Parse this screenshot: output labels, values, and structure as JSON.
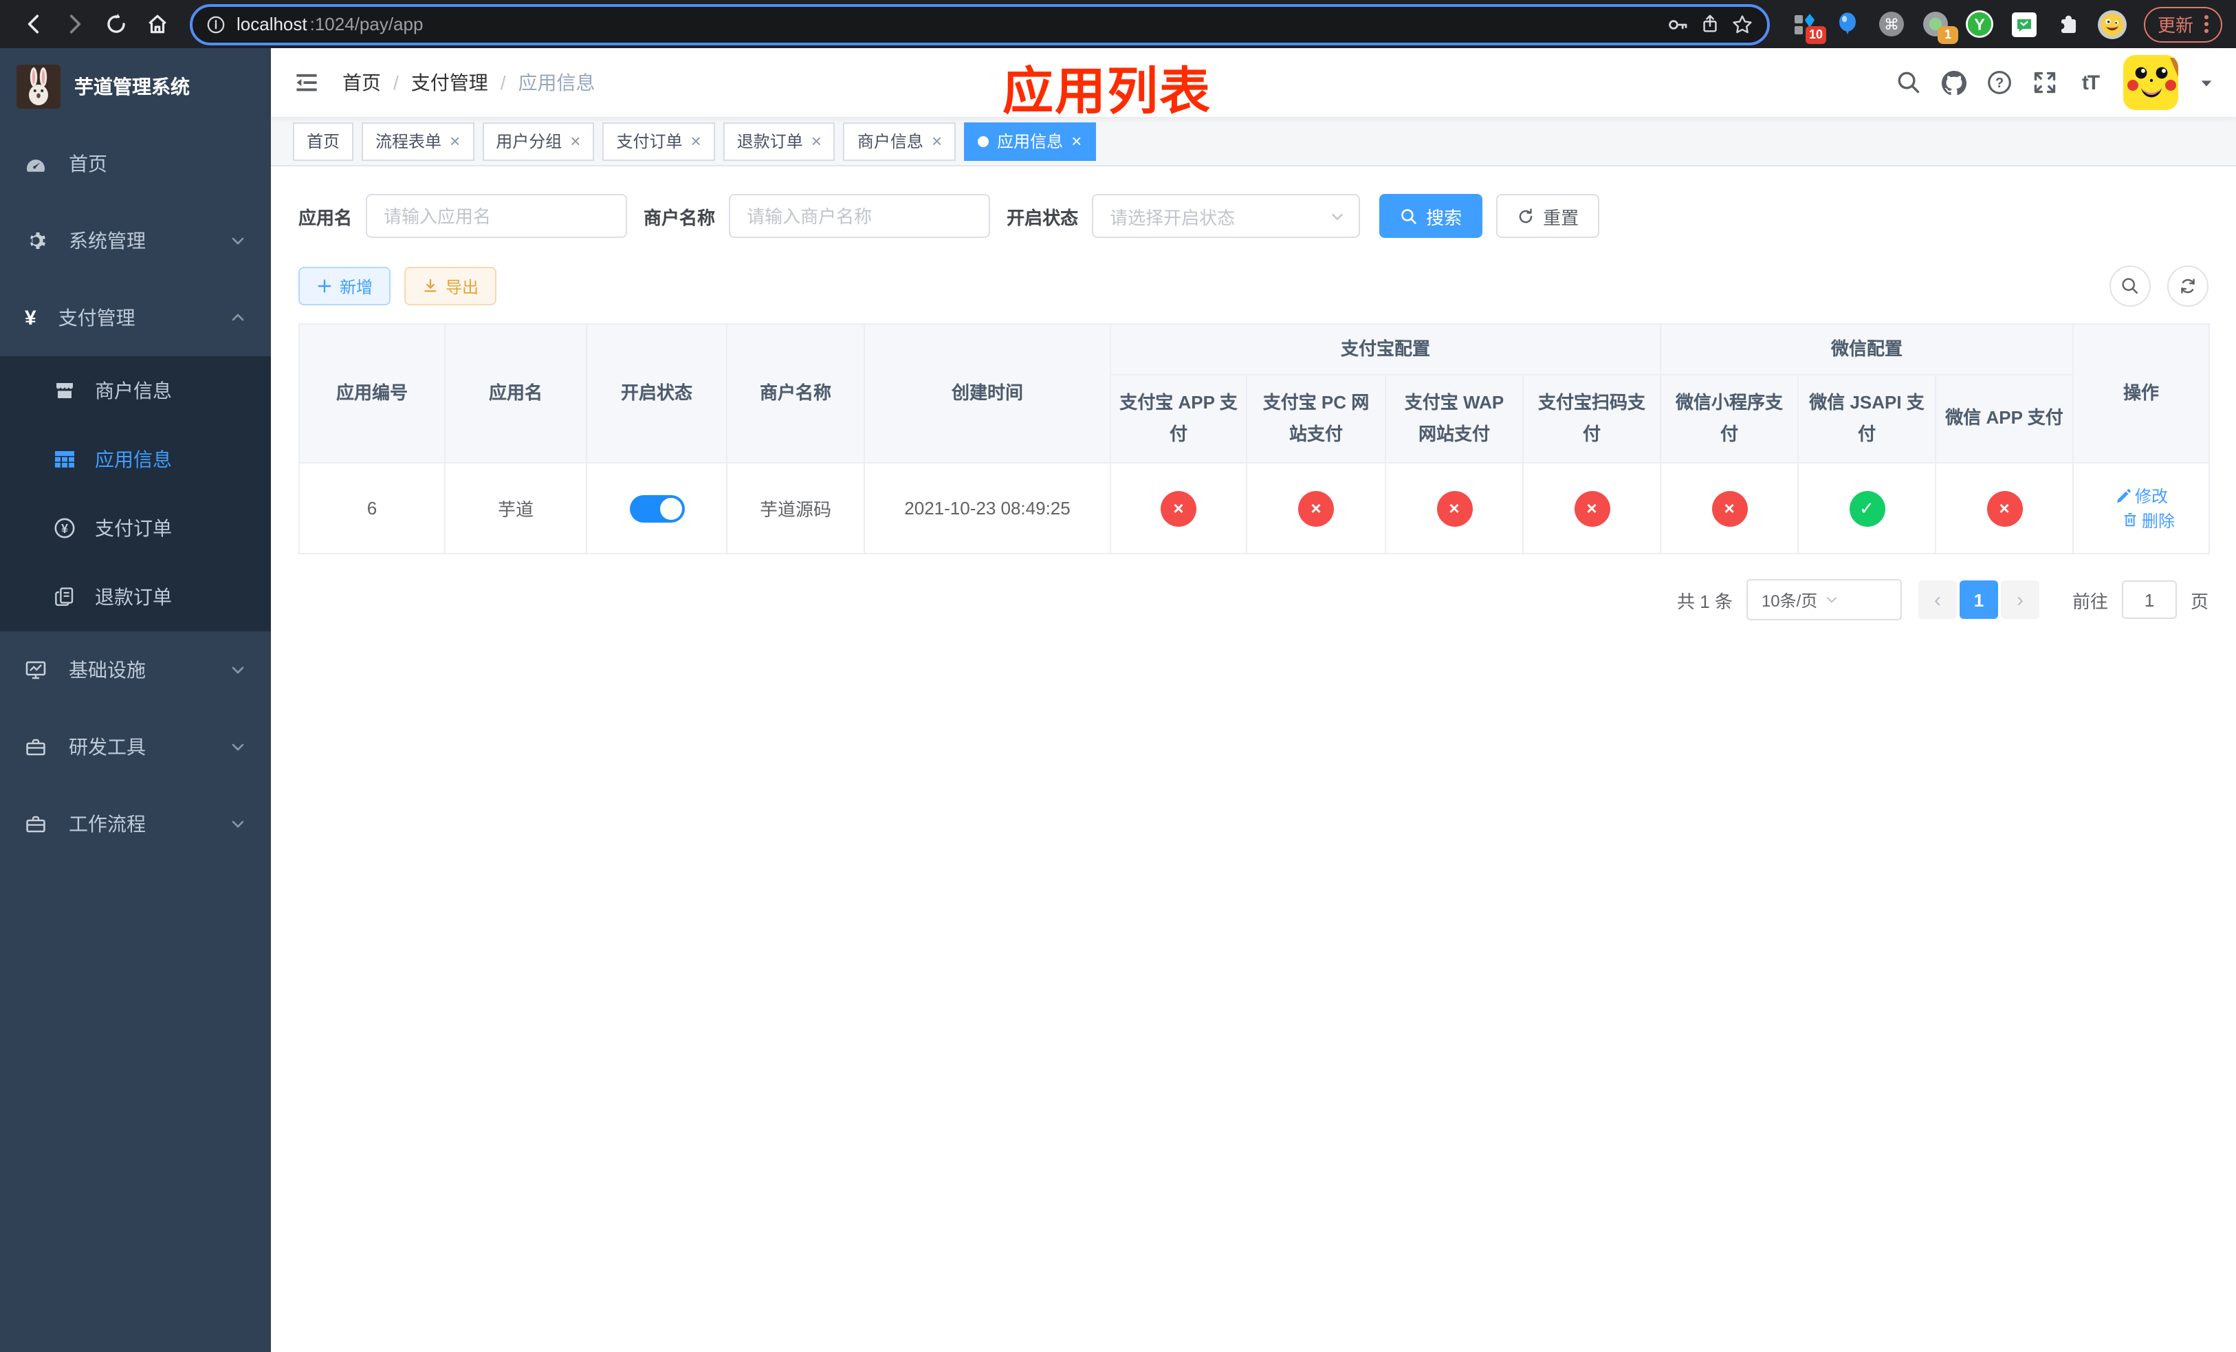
{
  "theme": {
    "accent": "#409eff",
    "switch_on": "#1c8cfc",
    "success": "#13ce66",
    "danger": "#f54c49",
    "annotation": "#fd2c00",
    "sidebar_bg": "#304156",
    "submenu_bg": "#1f2d3d",
    "chrome_bg": "#202124"
  },
  "icons": {
    "close": "×",
    "check": "✓",
    "cross": "×",
    "prev": "‹",
    "next": "›"
  },
  "browser": {
    "url_host": "localhost",
    "url_rest": ":1024/pay/app",
    "update_label": "更新",
    "extensions": {
      "badge1": "10",
      "badge2": "1"
    }
  },
  "sidebar": {
    "title": "芋道管理系统",
    "menu": [
      {
        "label": "首页"
      },
      {
        "label": "系统管理"
      },
      {
        "label": "支付管理"
      }
    ],
    "submenu": [
      {
        "label": "商户信息"
      },
      {
        "label": "应用信息"
      },
      {
        "label": "支付订单"
      },
      {
        "label": "退款订单"
      }
    ],
    "menu_bottom": [
      {
        "label": "基础设施"
      },
      {
        "label": "研发工具"
      },
      {
        "label": "工作流程"
      }
    ]
  },
  "header": {
    "breadcrumb": [
      "首页",
      "支付管理",
      "应用信息"
    ],
    "annotation": "应用列表"
  },
  "tabs": [
    {
      "label": "首页"
    },
    {
      "label": "流程表单"
    },
    {
      "label": "用户分组"
    },
    {
      "label": "支付订单"
    },
    {
      "label": "退款订单"
    },
    {
      "label": "商户信息"
    },
    {
      "label": "应用信息"
    }
  ],
  "filters": {
    "app_name_label": "应用名",
    "app_name_placeholder": "请输入应用名",
    "merchant_label": "商户名称",
    "merchant_placeholder": "请输入商户名称",
    "status_label": "开启状态",
    "status_placeholder": "请选择开启状态",
    "search_label": "搜索",
    "reset_label": "重置"
  },
  "toolbar": {
    "add_label": "新增",
    "export_label": "导出"
  },
  "table": {
    "group_headers": {
      "alipay": "支付宝配置",
      "wechat": "微信配置"
    },
    "columns": [
      "应用编号",
      "应用名",
      "开启状态",
      "商户名称",
      "创建时间",
      "支付宝 APP 支付",
      "支付宝 PC 网站支付",
      "支付宝 WAP 网站支付",
      "支付宝扫码支付",
      "微信小程序支付",
      "微信 JSAPI 支付",
      "微信 APP 支付",
      "操作"
    ],
    "rows": [
      {
        "id": "6",
        "name": "芋道",
        "enabled": true,
        "merchant": "芋道源码",
        "created": "2021-10-23 08:49:25",
        "configs": [
          false,
          false,
          false,
          false,
          false,
          true,
          false
        ],
        "actions": {
          "edit": "修改",
          "delete": "删除"
        }
      }
    ]
  },
  "pagination": {
    "total": "共 1 条",
    "page_size": "10条/页",
    "current_page": "1",
    "goto_label": "前往",
    "goto_value": "1",
    "page_suffix": "页"
  }
}
